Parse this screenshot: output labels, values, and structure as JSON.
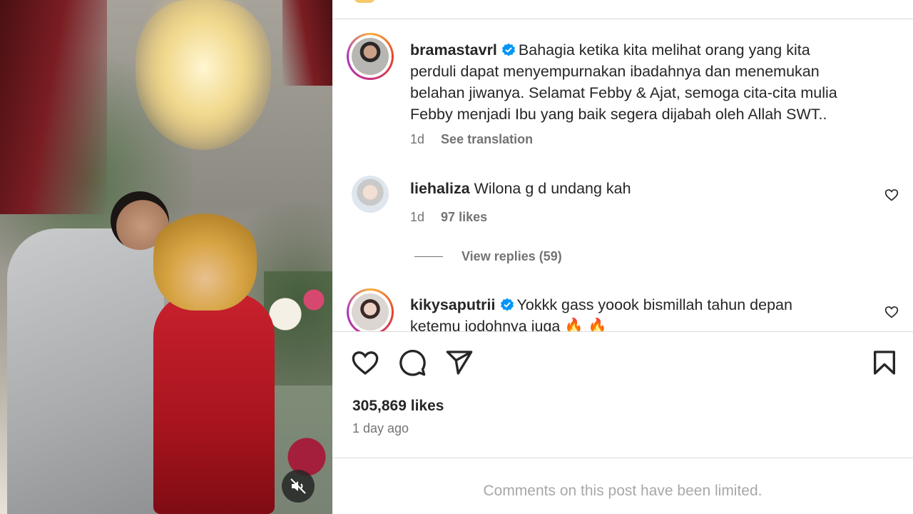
{
  "post": {
    "caption": {
      "username": "bramastavrl",
      "verified": true,
      "lines": [
        "Bahagia ketika kita melihat orang yang kita",
        "perduli dapat menyempurnakan ibadahnya dan menemukan",
        "belahan jiwanya. Selamat Febby & Ajat, semoga cita-cita mulia",
        "Febby menjadi Ibu yang baik segera dijabah oleh Allah SWT.."
      ],
      "time": "1d",
      "see_translation": "See translation"
    },
    "comments": [
      {
        "username": "liehaliza",
        "text": "Wilona g d undang kah",
        "time": "1d",
        "likes": "97 likes",
        "view_replies": "View replies (59)"
      },
      {
        "username": "kikysaputrii",
        "verified": true,
        "line1": "Yokkk gass yoook bismillah tahun depan",
        "line2": "ketemu jodohnya juga 🔥 🔥"
      }
    ],
    "likes_count": "305,869 likes",
    "posted": "1 day ago",
    "comments_limited": "Comments on this post have been limited."
  },
  "icons": {
    "like": "heart-icon",
    "comment": "comment-icon",
    "share": "send-icon",
    "save": "bookmark-icon",
    "mute": "speaker-muted-icon",
    "verified": "verified-badge-icon"
  },
  "colors": {
    "verified": "#0095f6",
    "text": "#262626",
    "secondary": "#737373",
    "divider": "#dbdbdb"
  }
}
